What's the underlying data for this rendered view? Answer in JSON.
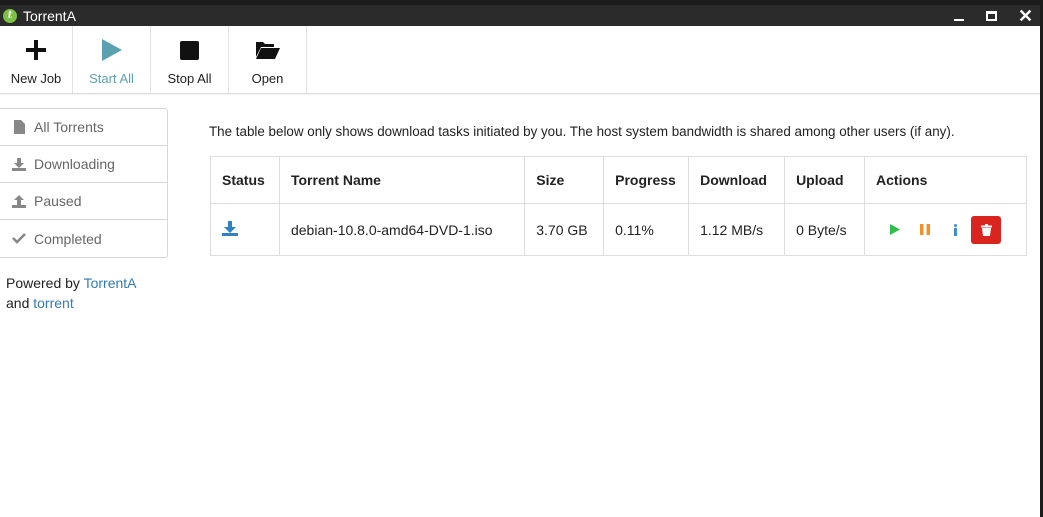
{
  "window": {
    "title": "TorrentA"
  },
  "toolbar": {
    "new_job": "New Job",
    "start_all": "Start All",
    "stop_all": "Stop All",
    "open": "Open"
  },
  "sidebar": {
    "items": [
      {
        "label": "All Torrents",
        "icon": "file-icon"
      },
      {
        "label": "Downloading",
        "icon": "download-icon"
      },
      {
        "label": "Paused",
        "icon": "upload-icon"
      },
      {
        "label": "Completed",
        "icon": "check-icon"
      }
    ],
    "powered_prefix": "Powered by",
    "powered_link1": "TorrentA",
    "powered_and": "and",
    "powered_link2": "torrent"
  },
  "main": {
    "notice": "The table below only shows download tasks initiated by you. The host system bandwidth is shared among other users (if any).",
    "columns": [
      "Status",
      "Torrent Name",
      "Size",
      "Progress",
      "Download",
      "Upload",
      "Actions"
    ],
    "rows": [
      {
        "status_icon": "download-icon",
        "name": "debian-10.8.0-amd64-DVD-1.iso",
        "size": "3.70 GB",
        "progress": "0.11%",
        "download": "1.12 MB/s",
        "upload": "0 Byte/s"
      }
    ]
  },
  "colors": {
    "accent_link": "#337ab7",
    "play": "#2fbf4a",
    "pause": "#f0922b",
    "info": "#3a8ed6",
    "delete": "#d9251d"
  }
}
